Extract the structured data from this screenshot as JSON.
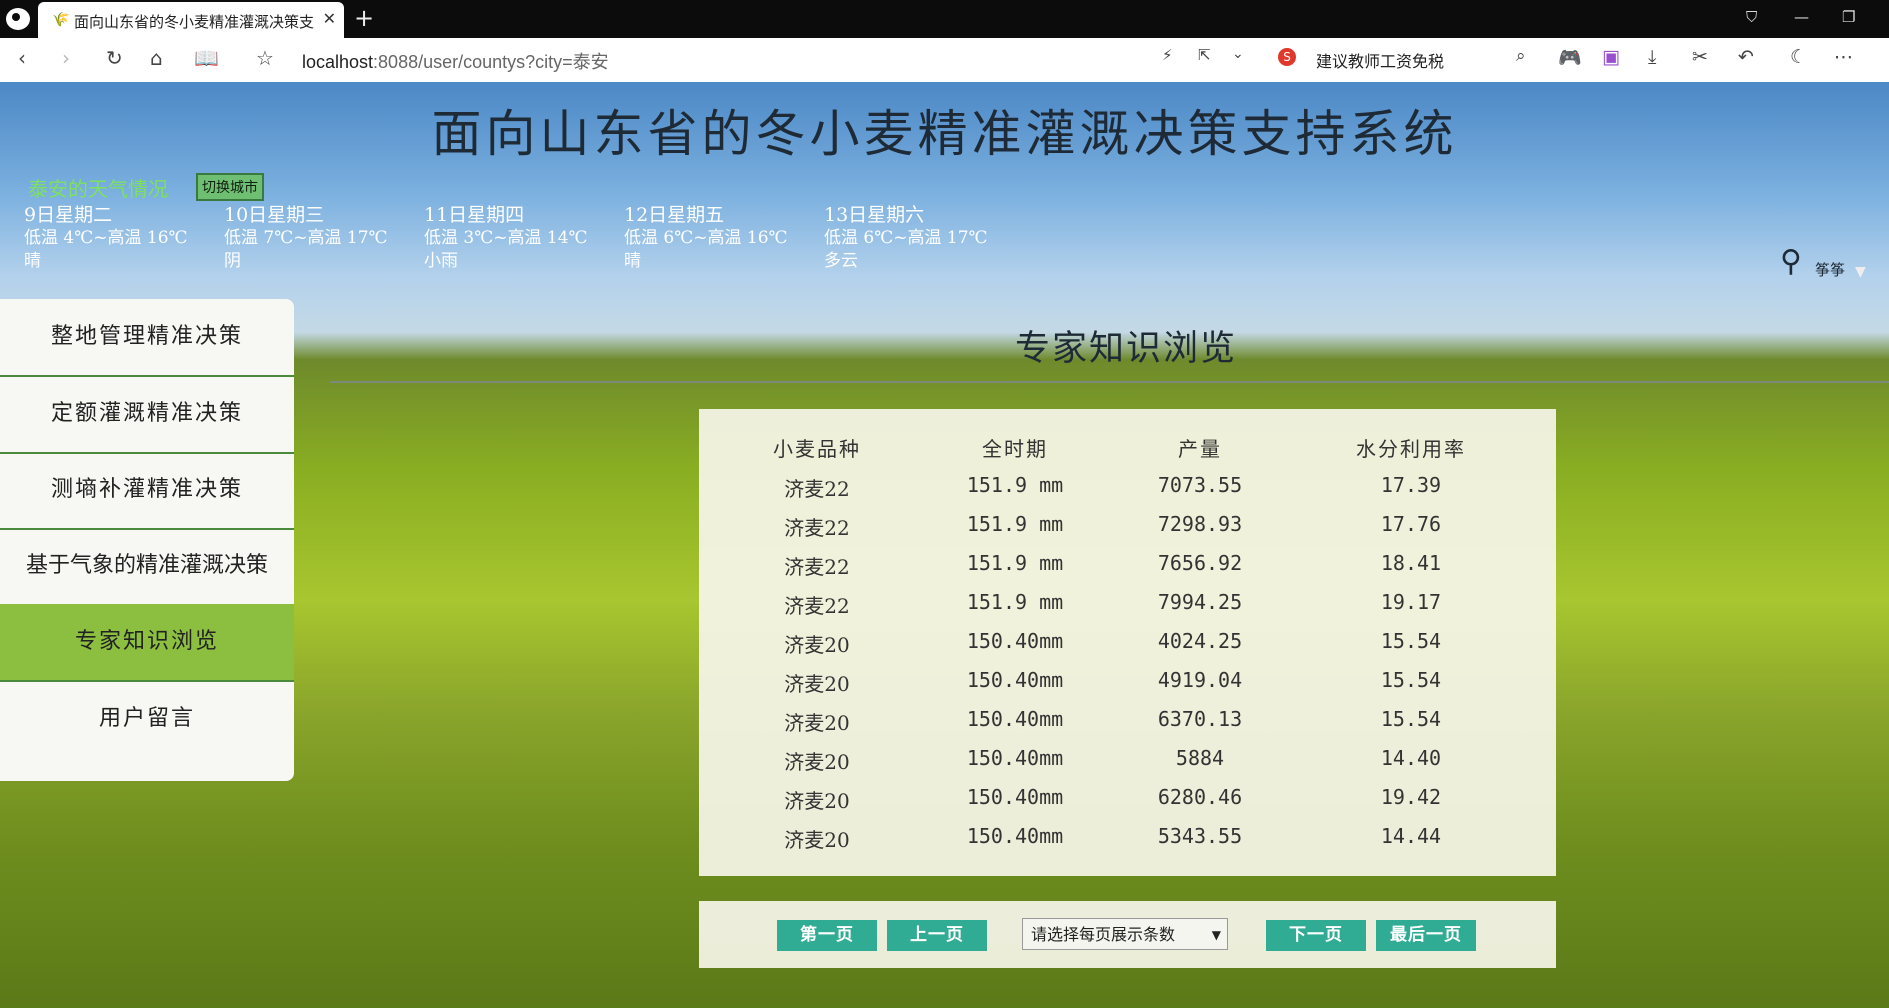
{
  "browser": {
    "tab_title": "面向山东省的冬小麦精准灌溉决策支持系统",
    "url_host": "localhost",
    "url_rest": ":8088/user/countys?city=泰安",
    "search_text": "建议教师工资免税"
  },
  "header": {
    "title": "面向山东省的冬小麦精准灌溉决策支持系统",
    "weather_title": "泰安的天气情况",
    "switch_city": "切换城市",
    "user_name": "筝筝"
  },
  "weather": [
    {
      "date": "9日星期二",
      "temp": "低温 4℃~高温 16℃",
      "cond": "晴"
    },
    {
      "date": "10日星期三",
      "temp": "低温 7℃~高温 17℃",
      "cond": "阴"
    },
    {
      "date": "11日星期四",
      "temp": "低温 3℃~高温 14℃",
      "cond": "小雨"
    },
    {
      "date": "12日星期五",
      "temp": "低温 6℃~高温 16℃",
      "cond": "晴"
    },
    {
      "date": "13日星期六",
      "temp": "低温 6℃~高温 17℃",
      "cond": "多云"
    }
  ],
  "sidebar": {
    "items": [
      {
        "label": "整地管理精准决策"
      },
      {
        "label": "定额灌溉精准决策"
      },
      {
        "label": "测墒补灌精准决策"
      },
      {
        "label": "基于气象的精准灌溉决策"
      },
      {
        "label": "专家知识浏览",
        "active": true
      },
      {
        "label": "用户留言"
      }
    ]
  },
  "main": {
    "section_title": "专家知识浏览",
    "table": {
      "headers": [
        "小麦品种",
        "全时期",
        "产量",
        "水分利用率"
      ],
      "rows": [
        [
          "济麦22",
          "151.9 mm",
          "7073.55",
          "17.39"
        ],
        [
          "济麦22",
          "151.9 mm",
          "7298.93",
          "17.76"
        ],
        [
          "济麦22",
          "151.9 mm",
          "7656.92",
          "18.41"
        ],
        [
          "济麦22",
          "151.9 mm",
          "7994.25",
          "19.17"
        ],
        [
          "济麦20",
          "150.40mm",
          "4024.25",
          "15.54"
        ],
        [
          "济麦20",
          "150.40mm",
          "4919.04",
          "15.54"
        ],
        [
          "济麦20",
          "150.40mm",
          "6370.13",
          "15.54"
        ],
        [
          "济麦20",
          "150.40mm",
          "5884",
          "14.40"
        ],
        [
          "济麦20",
          "150.40mm",
          "6280.46",
          "19.42"
        ],
        [
          "济麦20",
          "150.40mm",
          "5343.55",
          "14.44"
        ]
      ]
    },
    "pager": {
      "first": "第一页",
      "prev": "上一页",
      "page_size_select": "请选择每页展示条数",
      "next": "下一页",
      "last": "最后一页"
    }
  },
  "colors": {
    "accent_button": "#30ab94",
    "sidebar_active": "#8cbf3f",
    "weather_title": "#7ee060"
  }
}
